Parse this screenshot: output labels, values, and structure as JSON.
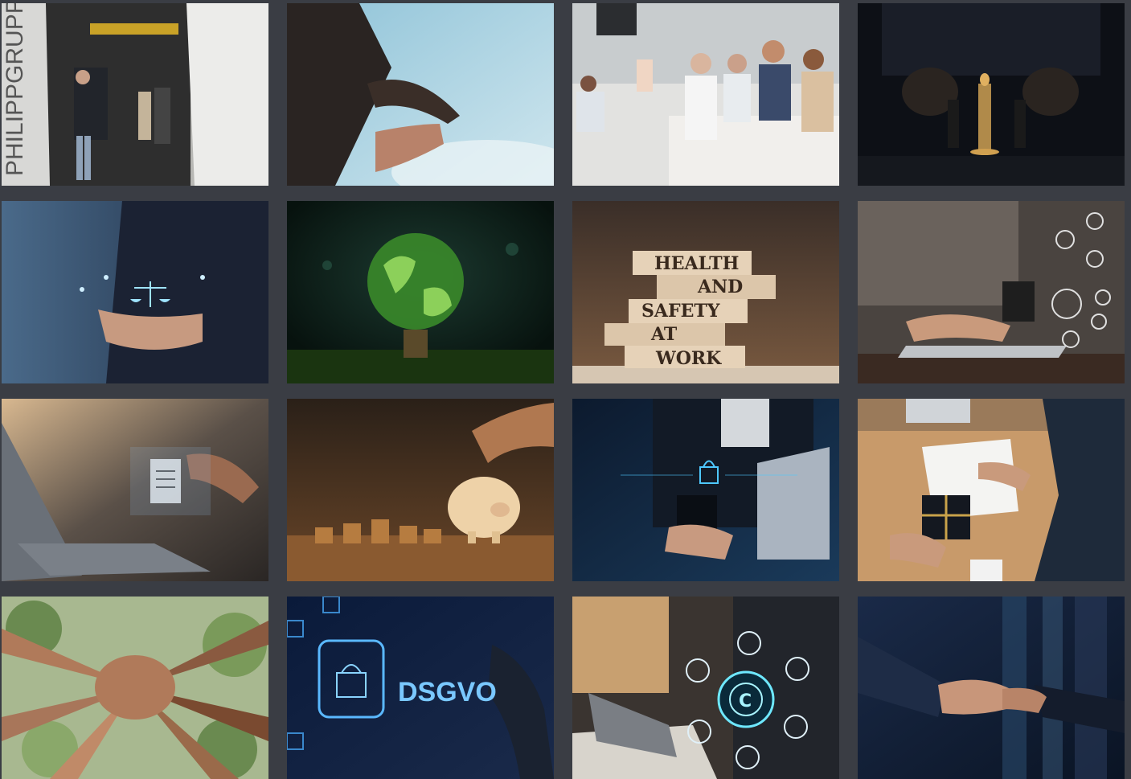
{
  "gallery": {
    "background": "#3a3d44",
    "tiles": [
      {
        "subject": "office-hallway",
        "texts": {
          "wall": "PHILIPPGRUPPE"
        }
      },
      {
        "subject": "reaching-hands-sky"
      },
      {
        "subject": "team-meeting"
      },
      {
        "subject": "chess-pieces"
      },
      {
        "subject": "justice-scale-hand"
      },
      {
        "subject": "globe-light-bulb"
      },
      {
        "subject": "wooden-planks-sign",
        "texts": {
          "line1": "HEALTH",
          "line2": "AND",
          "line3": "SAFETY",
          "line4": "AT",
          "line5": "WORK"
        }
      },
      {
        "subject": "laptop-social-icons"
      },
      {
        "subject": "laptop-document"
      },
      {
        "subject": "piggy-bank-coins"
      },
      {
        "subject": "smartphone-lock"
      },
      {
        "subject": "gift-exchange-desk"
      },
      {
        "subject": "stacked-hands"
      },
      {
        "subject": "dsgvo-lock",
        "texts": {
          "label": "DSGVO"
        }
      },
      {
        "subject": "copyright-network"
      },
      {
        "subject": "handshake-city"
      }
    ]
  }
}
